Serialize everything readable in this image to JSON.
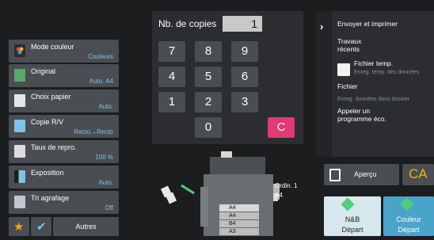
{
  "settings": [
    {
      "label": "Mode couleur",
      "value": "Couleurs",
      "icon": "color-mode-icon"
    },
    {
      "label": "Original",
      "value": "Auto. A4",
      "icon": "original-icon"
    },
    {
      "label": "Choix papier",
      "value": "Auto.",
      "icon": "paper-select-icon"
    },
    {
      "label": "Copie R/V",
      "value": "Recto→Recto",
      "icon": "duplex-icon"
    },
    {
      "label": "Taux de repro.",
      "value": "100 %",
      "icon": "zoom-ratio-icon"
    },
    {
      "label": "Exposition",
      "value": "Auto.",
      "icon": "exposure-icon"
    },
    {
      "label": "Tri agrafage",
      "value": "Off",
      "icon": "sort-staple-icon"
    }
  ],
  "bottom_bar": {
    "others_label": "Autres"
  },
  "copies": {
    "label": "Nb. de copies",
    "value": "1"
  },
  "keypad": {
    "keys": [
      "7",
      "8",
      "9",
      "4",
      "5",
      "6",
      "1",
      "2",
      "3",
      "0"
    ],
    "clear_label": "C"
  },
  "machine": {
    "output_tray_label": "Ordin. 1",
    "output_paper": "A4",
    "trays": [
      "A4",
      "A4",
      "B4",
      "A3"
    ]
  },
  "right_panel": {
    "send_print": "Envoyer et imprimer",
    "recent_jobs": "Travaux\nrécents",
    "temp_file": "Fichier temp.",
    "temp_file_sub": "Enreg. temp. des données",
    "file": "Fichier",
    "file_sub": "Enreg. données dans dossier",
    "eco_program": "Appeler un\nprogramme éco."
  },
  "actions": {
    "preview_label": "Aperçu",
    "ca_label": "CA",
    "bw_start_line1": "N&B",
    "bw_start_line2": "Départ",
    "color_start_line1": "Couleur",
    "color_start_line2": "Départ"
  },
  "colors": {
    "accent_blue": "#7ec3e8",
    "clear_key": "#e23a72",
    "ca_text": "#f2b500",
    "start_bg": "#d7e7ee",
    "color_start_bg": "#4aa3c9"
  }
}
